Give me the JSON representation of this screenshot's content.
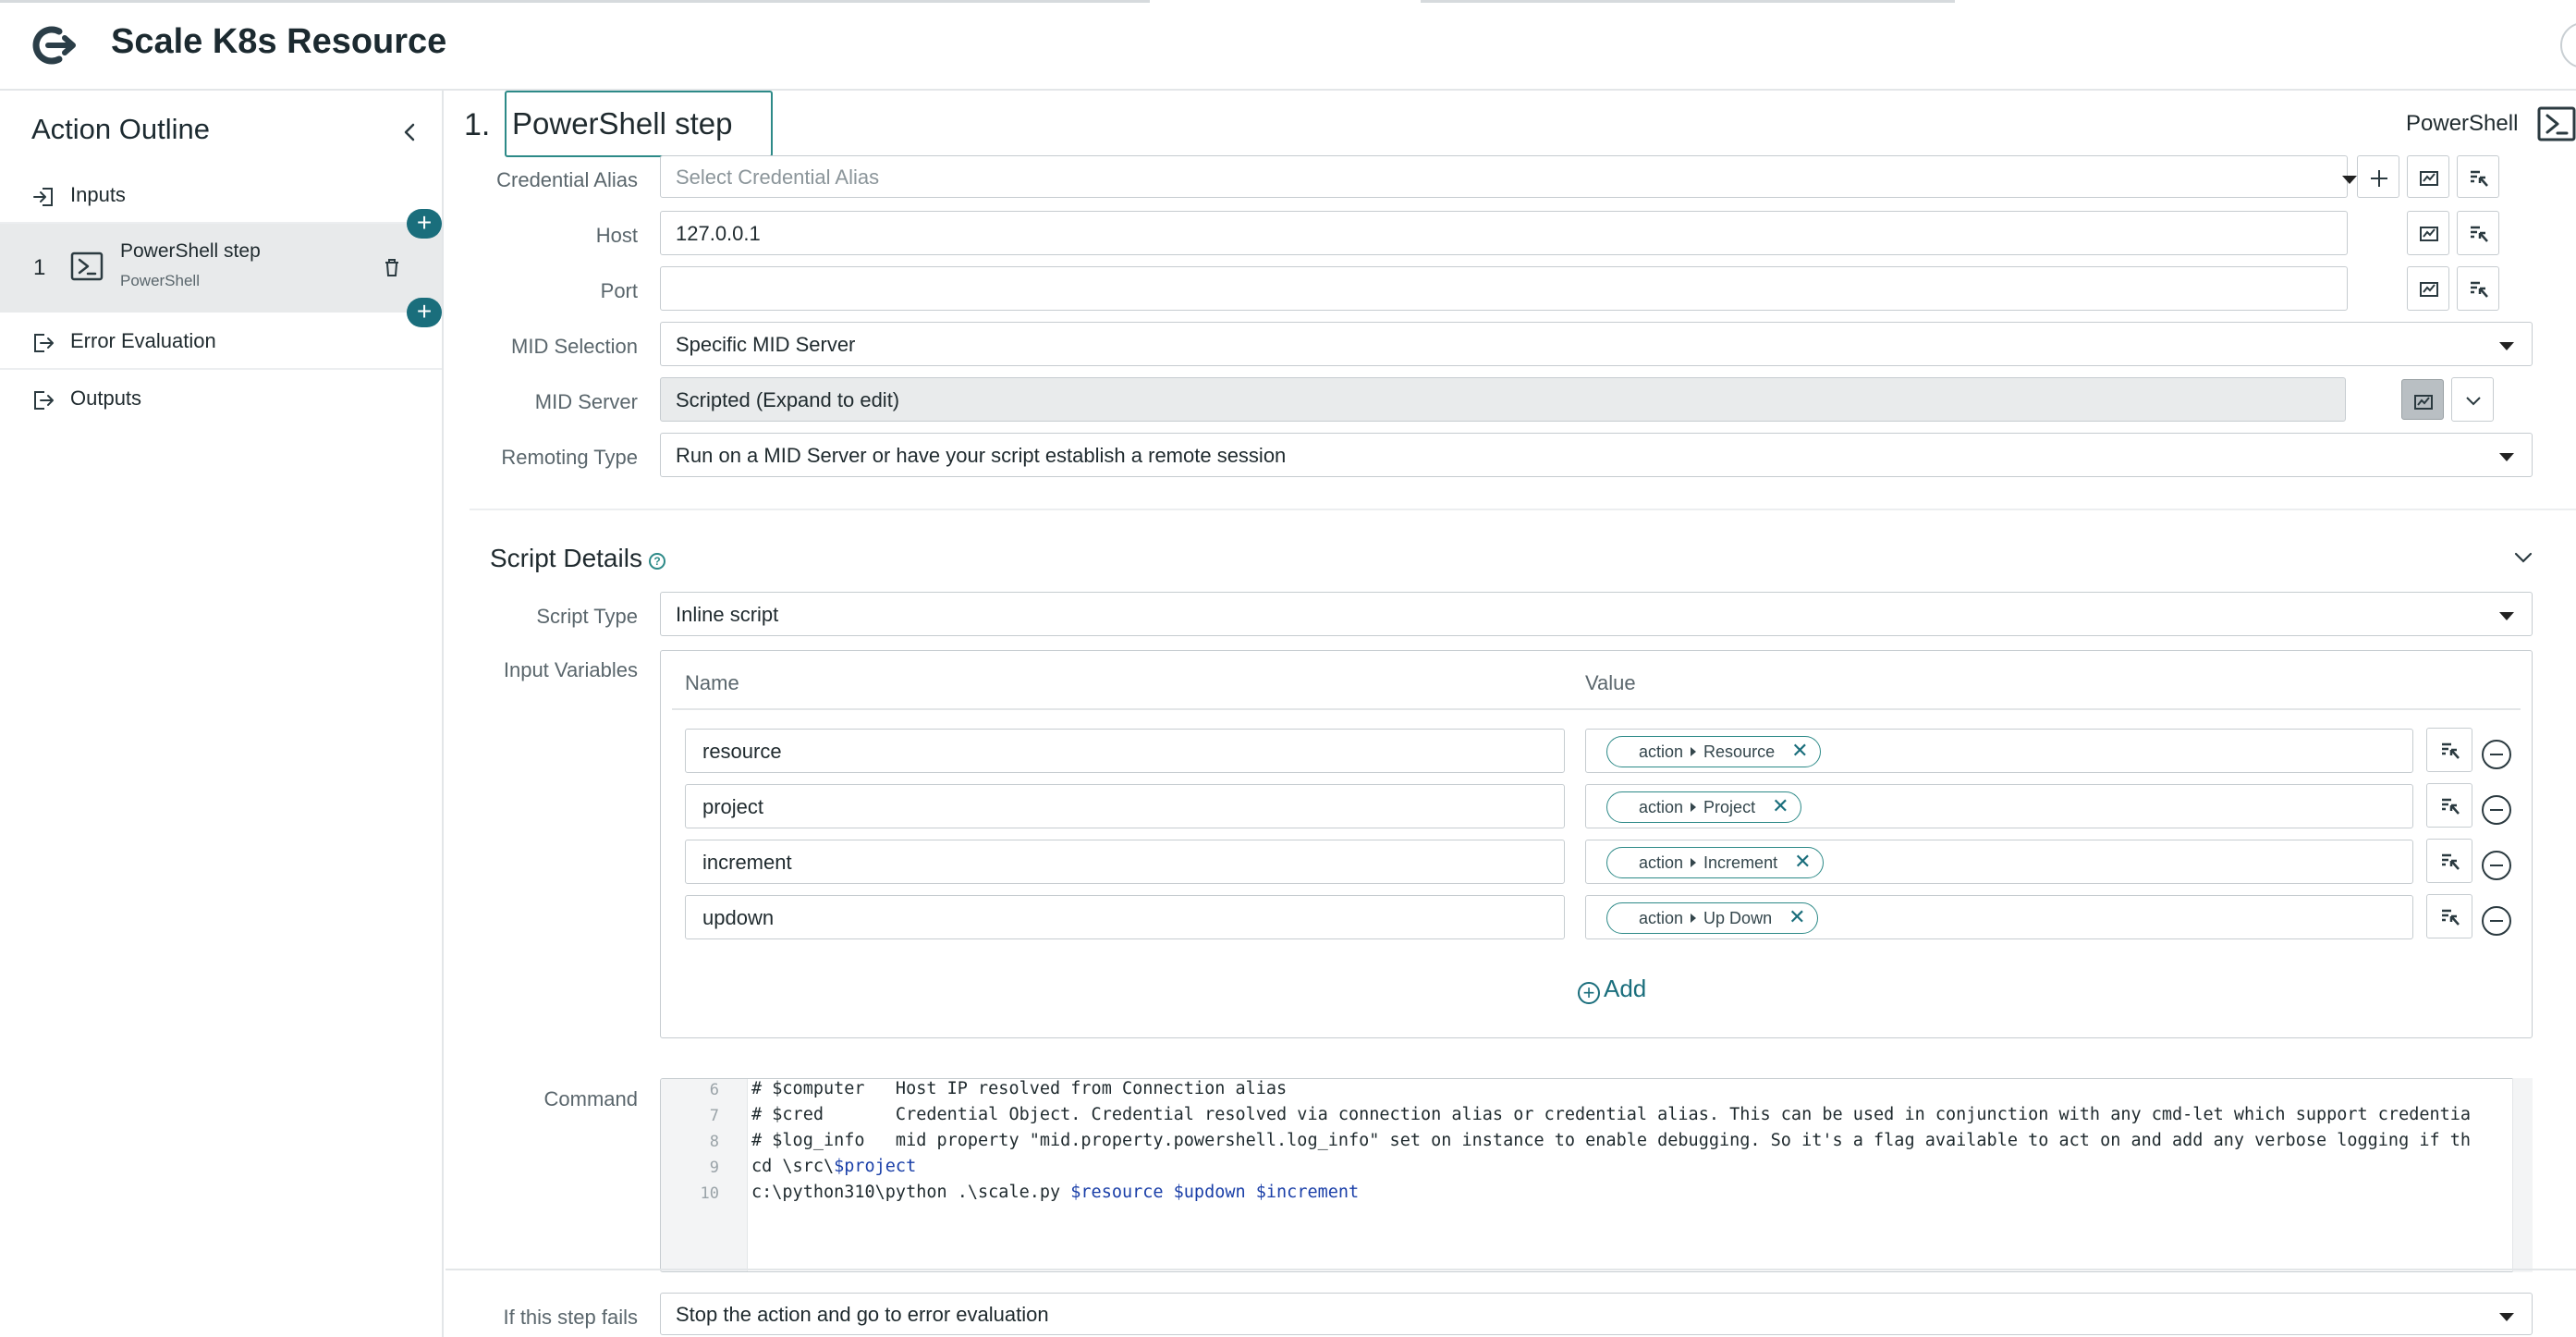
{
  "app": {
    "title": "Scale K8s Resource"
  },
  "sidebar": {
    "heading": "Action Outline",
    "inputs_label": "Inputs",
    "step": {
      "number": "1",
      "name": "PowerShell step",
      "type": "PowerShell"
    },
    "error_label": "Error Evaluation",
    "outputs_label": "Outputs"
  },
  "step_header": {
    "number": "1.",
    "name": "PowerShell step",
    "type_label": "PowerShell"
  },
  "connection": {
    "credential_alias": {
      "label": "Credential Alias",
      "placeholder": "Select Credential Alias"
    },
    "host": {
      "label": "Host",
      "value": "127.0.0.1"
    },
    "port": {
      "label": "Port",
      "value": ""
    },
    "mid_selection": {
      "label": "MID Selection",
      "value": "Specific MID Server"
    },
    "mid_server": {
      "label": "MID Server",
      "value": "Scripted (Expand to edit)"
    },
    "remoting_type": {
      "label": "Remoting Type",
      "value": "Run on a MID Server or have your script establish a remote session"
    }
  },
  "script_details": {
    "title": "Script Details",
    "script_type": {
      "label": "Script Type",
      "value": "Inline script"
    },
    "input_variables": {
      "label": "Input Variables",
      "name_header": "Name",
      "value_header": "Value",
      "rows": [
        {
          "name": "resource",
          "pill_source": "action",
          "pill_field": "Resource"
        },
        {
          "name": "project",
          "pill_source": "action",
          "pill_field": "Project"
        },
        {
          "name": "increment",
          "pill_source": "action",
          "pill_field": "Increment"
        },
        {
          "name": "updown",
          "pill_source": "action",
          "pill_field": "Up Down"
        }
      ],
      "add_label": "Add"
    },
    "command": {
      "label": "Command",
      "line_numbers": [
        "6",
        "7",
        "8",
        "9",
        "10"
      ],
      "lines": [
        "# $computer   Host IP resolved from Connection alias",
        "# $cred       Credential Object. Credential resolved via connection alias or credential alias. This can be used in conjunction with any cmd-let which support credentia",
        "# $log_info   mid property \"mid.property.powershell.log_info\" set on instance to enable debugging. So it's a flag available to act on and add any verbose logging if th",
        "cd \\src\\",
        "c:\\python310\\python .\\scale.py "
      ],
      "line4_var": "$project",
      "line5_vars": "$resource $updown $increment"
    }
  },
  "on_failure": {
    "label": "If this step fails",
    "value": "Stop the action and go to error evaluation"
  },
  "colors": {
    "accent": "#1a6e7c",
    "focus_border": "#2d8a88",
    "readonly_bg": "#e9ebec"
  }
}
